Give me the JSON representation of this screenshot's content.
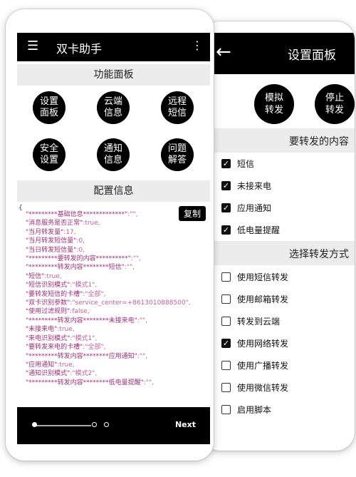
{
  "front": {
    "app_title": "双卡助手",
    "menu_icon": "menu-icon",
    "more_icon": "more-vert-icon",
    "panel_header": "功能面板",
    "buttons": [
      {
        "line1": "设置",
        "line2": "面板"
      },
      {
        "line1": "云端",
        "line2": "信息"
      },
      {
        "line1": "远程",
        "line2": "短信"
      },
      {
        "line1": "安全",
        "line2": "设置"
      },
      {
        "line1": "通知",
        "line2": "信息"
      },
      {
        "line1": "问题",
        "line2": "解答"
      }
    ],
    "config_header": "配置信息",
    "copy_label": "复制",
    "config_brace": "{",
    "config_lines": [
      {
        "k": "\"*********基础信息*************\"",
        "v": ":\"\","
      },
      {
        "k": "\"消息服务是否正常\"",
        "v": ":true,"
      },
      {
        "k": "\"当月转发量\"",
        "v": ":17,"
      },
      {
        "k": "\"当月转发短信量\"",
        "v": ":0,"
      },
      {
        "k": "\"当日转发短信量\"",
        "v": ":0,"
      },
      {
        "k": "\"*********要转发的内容**********\"",
        "v": ":\"\","
      },
      {
        "k": "\"*********转发内容********短信\"",
        "v": ":\"\","
      },
      {
        "k": "\"短信\"",
        "v": ":true,"
      },
      {
        "k": "\"短信识别模式\"",
        "v": ":\"模式1\","
      },
      {
        "k": "\"要转发短信的卡槽\"",
        "v": ":\"全部\","
      },
      {
        "k": "\"双卡识别参数\"",
        "v": ":\"service_center=+8613010888500\","
      },
      {
        "k": "\"使用过滤规则\"",
        "v": ":false,"
      },
      {
        "k": "\"*********转发内容********未接来电\"",
        "v": ":\"\","
      },
      {
        "k": "\"未接来电\"",
        "v": ":true,"
      },
      {
        "k": "\"来电识别模式\"",
        "v": ":\"模式1\","
      },
      {
        "k": "\"要转发来电的卡槽\"",
        "v": ":\"全部\","
      },
      {
        "k": "\"*********转发内容********应用通知\"",
        "v": ":\"\","
      },
      {
        "k": "\"应用通知\"",
        "v": ":true,"
      },
      {
        "k": "\"通知识别模式\"",
        "v": ":\"模式2\","
      },
      {
        "k": "\"*********转发内容********低电量提醒\"",
        "v": ":\"\","
      }
    ],
    "nav_next": "Next"
  },
  "back": {
    "title": "设置面板",
    "back_icon": "back-arrow-icon",
    "top_buttons": [
      {
        "line1": "模拟",
        "line2": "转发"
      },
      {
        "line1": "停止",
        "line2": "转发"
      }
    ],
    "content_section": "要转发的内容",
    "content_items": [
      {
        "label": "短信",
        "checked": true
      },
      {
        "label": "未接来电",
        "checked": true
      },
      {
        "label": "应用通知",
        "checked": true
      },
      {
        "label": "低电量提醒",
        "checked": true
      }
    ],
    "method_section": "选择转发方式",
    "method_items": [
      {
        "label": "使用短信转发",
        "checked": false
      },
      {
        "label": "使用邮箱转发",
        "checked": false
      },
      {
        "label": "转发到云端",
        "checked": false
      },
      {
        "label": "使用网络转发",
        "checked": true
      },
      {
        "label": "使用广播转发",
        "checked": false
      },
      {
        "label": "使用微信转发",
        "checked": false
      },
      {
        "label": "启用脚本",
        "checked": false
      }
    ]
  }
}
